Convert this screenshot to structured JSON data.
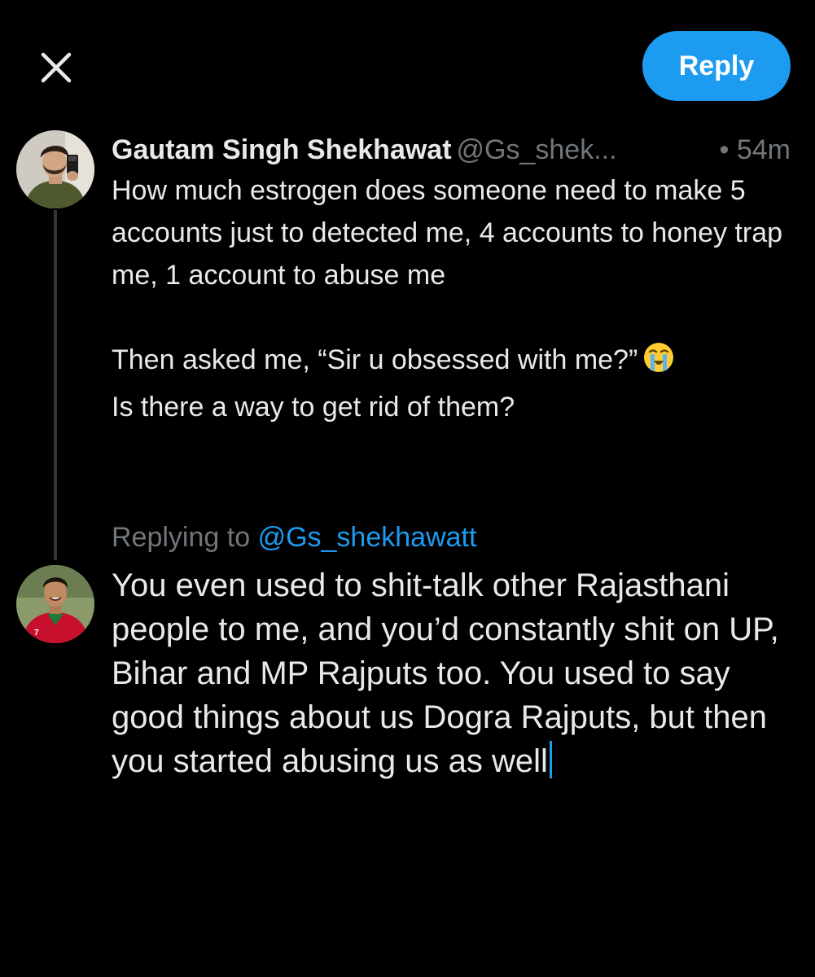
{
  "header": {
    "close_icon": "close-icon",
    "reply_label": "Reply"
  },
  "colors": {
    "accent": "#1d9bf0",
    "background": "#000000",
    "text_primary": "#e7e9ea",
    "text_secondary": "#71767b",
    "thread_line": "#333639"
  },
  "original_tweet": {
    "display_name": "Gautam Singh Shekhawat",
    "handle": "@Gs_shek...",
    "separator": "•",
    "time": "54m",
    "text_paragraph_1": "How much estrogen does someone need to make 5 accounts just to detected me, 4 accounts to honey trap me, 1 account to abuse me",
    "text_paragraph_2a": "Then asked me, “Sir u obsessed with me?”",
    "text_paragraph_2a_emoji": "loudly-crying-face-emoji",
    "text_paragraph_2b": "Is there a way to get rid of them?"
  },
  "reply_compose": {
    "replying_to_label": "Replying to",
    "replying_to_handle": "@Gs_shekhawatt",
    "draft_text": "You even used to shit-talk other Rajasthani people to me, and you’d constantly shit on UP, Bihar and MP Rajputs too. You used to say good things about us Dogra Rajputs, but then you started abusing us as well"
  }
}
